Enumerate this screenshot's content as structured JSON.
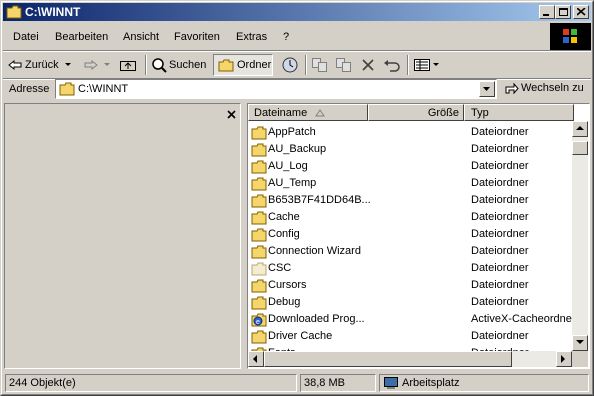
{
  "window": {
    "title": "C:\\WINNT",
    "controls": [
      "minimize",
      "maximize",
      "close"
    ]
  },
  "menubar": {
    "items": [
      "Datei",
      "Bearbeiten",
      "Ansicht",
      "Favoriten",
      "Extras",
      "?"
    ]
  },
  "toolbar": {
    "back_label": "Zurück",
    "search_label": "Suchen",
    "folders_label": "Ordner"
  },
  "address": {
    "label": "Adresse",
    "value": "C:\\WINNT",
    "go_label": "Wechseln zu"
  },
  "list": {
    "columns": {
      "name": "Dateiname",
      "size": "Größe",
      "type": "Typ"
    },
    "rows": [
      {
        "name": "AppPatch",
        "type": "Dateiordner",
        "icon": "folder-icon"
      },
      {
        "name": "AU_Backup",
        "type": "Dateiordner",
        "icon": "folder-icon"
      },
      {
        "name": "AU_Log",
        "type": "Dateiordner",
        "icon": "folder-icon"
      },
      {
        "name": "AU_Temp",
        "type": "Dateiordner",
        "icon": "folder-icon"
      },
      {
        "name": "B653B7F41DD64B...",
        "type": "Dateiordner",
        "icon": "folder-icon"
      },
      {
        "name": "Cache",
        "type": "Dateiordner",
        "icon": "folder-icon"
      },
      {
        "name": "Config",
        "type": "Dateiordner",
        "icon": "folder-icon"
      },
      {
        "name": "Connection Wizard",
        "type": "Dateiordner",
        "icon": "folder-icon"
      },
      {
        "name": "CSC",
        "type": "Dateiordner",
        "icon": "hidden-folder-icon"
      },
      {
        "name": "Cursors",
        "type": "Dateiordner",
        "icon": "folder-icon"
      },
      {
        "name": "Debug",
        "type": "Dateiordner",
        "icon": "folder-icon"
      },
      {
        "name": "Downloaded Prog...",
        "type": "ActiveX-Cacheordner",
        "icon": "activex-folder-icon"
      },
      {
        "name": "Driver Cache",
        "type": "Dateiordner",
        "icon": "folder-icon"
      },
      {
        "name": "Fonts",
        "type": "Dateiordner",
        "icon": "folder-icon"
      }
    ]
  },
  "statusbar": {
    "objects": "244 Objekt(e)",
    "size": "38,8 MB",
    "zone": "Arbeitsplatz"
  },
  "colors": {
    "title_start": "#0a246a",
    "title_end": "#a6caf0",
    "face": "#d4d0c8",
    "folder": "#f5d66b"
  }
}
